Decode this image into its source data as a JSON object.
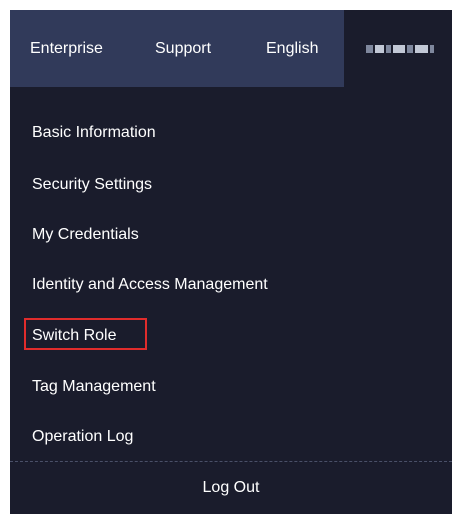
{
  "header": {
    "nav": [
      "Enterprise",
      "Support",
      "English"
    ],
    "user_name": ""
  },
  "menu": {
    "items": [
      {
        "label": "Basic Information"
      },
      {
        "label": "Security Settings"
      },
      {
        "label": "My Credentials"
      },
      {
        "label": "Identity and Access Management"
      },
      {
        "label": "Switch Role",
        "highlighted": true
      },
      {
        "label": "Tag Management"
      },
      {
        "label": "Operation Log"
      }
    ],
    "logout_label": "Log Out"
  },
  "colors": {
    "topbar_bg": "#313a5a",
    "menu_bg": "#1a1c2c",
    "highlight_border": "#e02c2c",
    "text": "#ffffff"
  }
}
